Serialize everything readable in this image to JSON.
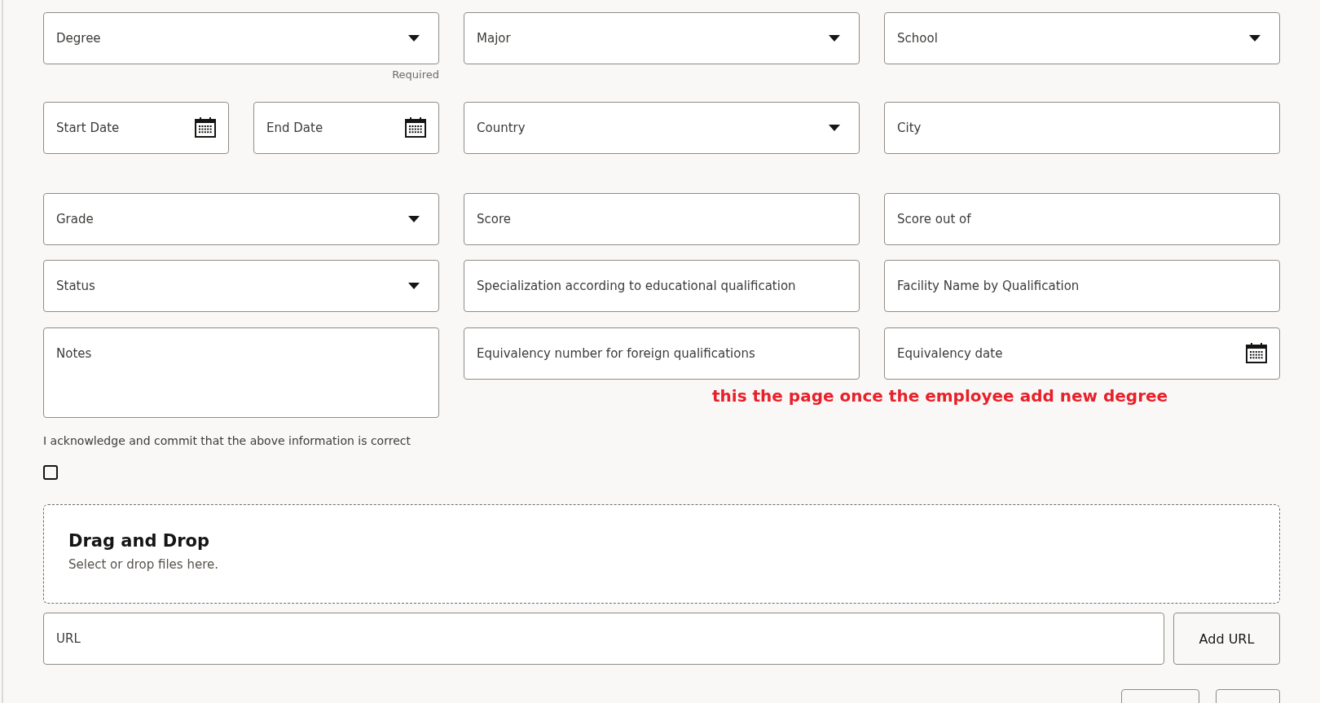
{
  "rows": [
    {
      "fields": [
        {
          "kind": "select",
          "placeholder": "Degree",
          "hint": "Required"
        },
        {
          "kind": "select",
          "placeholder": "Major"
        },
        {
          "kind": "select",
          "placeholder": "School"
        }
      ]
    },
    {
      "fields": [
        {
          "kind": "date",
          "placeholder": "Start Date",
          "half": true
        },
        {
          "kind": "date",
          "placeholder": "End Date",
          "half": true
        },
        {
          "kind": "select",
          "placeholder": "Country"
        },
        {
          "kind": "text",
          "placeholder": "City"
        }
      ]
    },
    {
      "fields": [
        {
          "kind": "select",
          "placeholder": "Grade"
        },
        {
          "kind": "text",
          "placeholder": "Score"
        },
        {
          "kind": "text",
          "placeholder": "Score out of"
        }
      ]
    },
    {
      "fields": [
        {
          "kind": "select",
          "placeholder": "Status"
        },
        {
          "kind": "text",
          "placeholder": "Specialization according to educational qualification"
        },
        {
          "kind": "text",
          "placeholder": "Facility Name by Qualification"
        }
      ]
    },
    {
      "fields": [
        {
          "kind": "textarea",
          "placeholder": "Notes"
        },
        {
          "kind": "text",
          "placeholder": "Equivalency number for foreign qualifications"
        },
        {
          "kind": "date",
          "placeholder": "Equivalency date"
        }
      ]
    }
  ],
  "annotation": "this the page once the employee add new degree",
  "acknowledgement": {
    "text": "I acknowledge and commit that the above information is correct",
    "checked": false
  },
  "dropzone": {
    "title": "Drag and Drop",
    "subtitle": "Select or drop files here."
  },
  "url": {
    "placeholder": "URL",
    "button": "Add URL"
  }
}
